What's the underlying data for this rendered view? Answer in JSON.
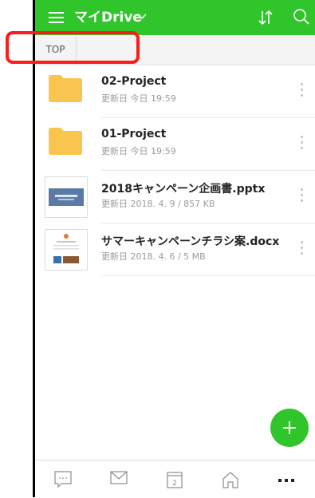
{
  "header": {
    "title": "マイDrive",
    "bg_color": "#2fc52b"
  },
  "breadcrumb": {
    "items": [
      "TOP"
    ],
    "highlight_color": "#ff1b1b"
  },
  "files": [
    {
      "name": "02-Project",
      "meta": "更新日 今日 19:59",
      "kind": "folder"
    },
    {
      "name": "01-Project",
      "meta": "更新日 今日 19:59",
      "kind": "folder"
    },
    {
      "name": "2018キャンペーン企画書.pptx",
      "meta": "更新日 2018. 4. 9 / 857 KB",
      "kind": "pptx"
    },
    {
      "name": "サマーキャンペーンチラシ案.docx",
      "meta": "更新日 2018. 4. 6 / 5 MB",
      "kind": "docx"
    }
  ],
  "bottom_nav": {
    "items": [
      "chat-icon",
      "mail-icon",
      "calendar-icon",
      "home-icon",
      "more-icon"
    ],
    "calendar_day": "2"
  },
  "fab": {
    "icon": "plus-icon"
  }
}
